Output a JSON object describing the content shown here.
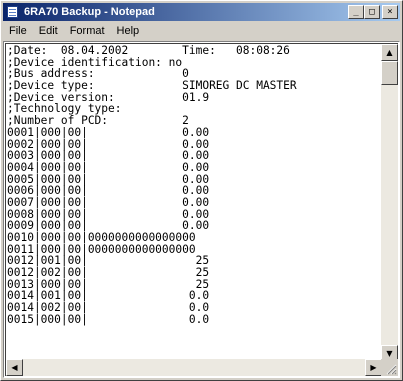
{
  "window": {
    "title": "6RA70 Backup - Notepad",
    "controls": {
      "minimize": "_",
      "maximize": "□",
      "close": "×"
    }
  },
  "menu": {
    "file": "File",
    "edit": "Edit",
    "format": "Format",
    "help": "Help"
  },
  "document": {
    "lines": [
      ";Date:  08.04.2002        Time:   08:08:26",
      ";Device identification: no",
      ";Bus address:             0",
      ";Device type:             SIMOREG DC MASTER",
      ";Device version:          01.9",
      ";Technology type:",
      ";Number of PCD:           2",
      "0001|000|00|              0.00",
      "0002|000|00|              0.00",
      "0003|000|00|              0.00",
      "0004|000|00|              0.00",
      "0005|000|00|              0.00",
      "0006|000|00|              0.00",
      "0007|000|00|              0.00",
      "0008|000|00|              0.00",
      "0009|000|00|              0.00",
      "0010|000|00|0000000000000000",
      "0011|000|00|0000000000000000",
      "0012|001|00|                25",
      "0012|002|00|                25",
      "0013|000|00|                25",
      "0014|001|00|               0.0",
      "0014|002|00|               0.0",
      "0015|000|00|               0.0"
    ]
  },
  "scrollbars": {
    "vertical_position": 0.0,
    "horizontal_position": 0.0
  }
}
